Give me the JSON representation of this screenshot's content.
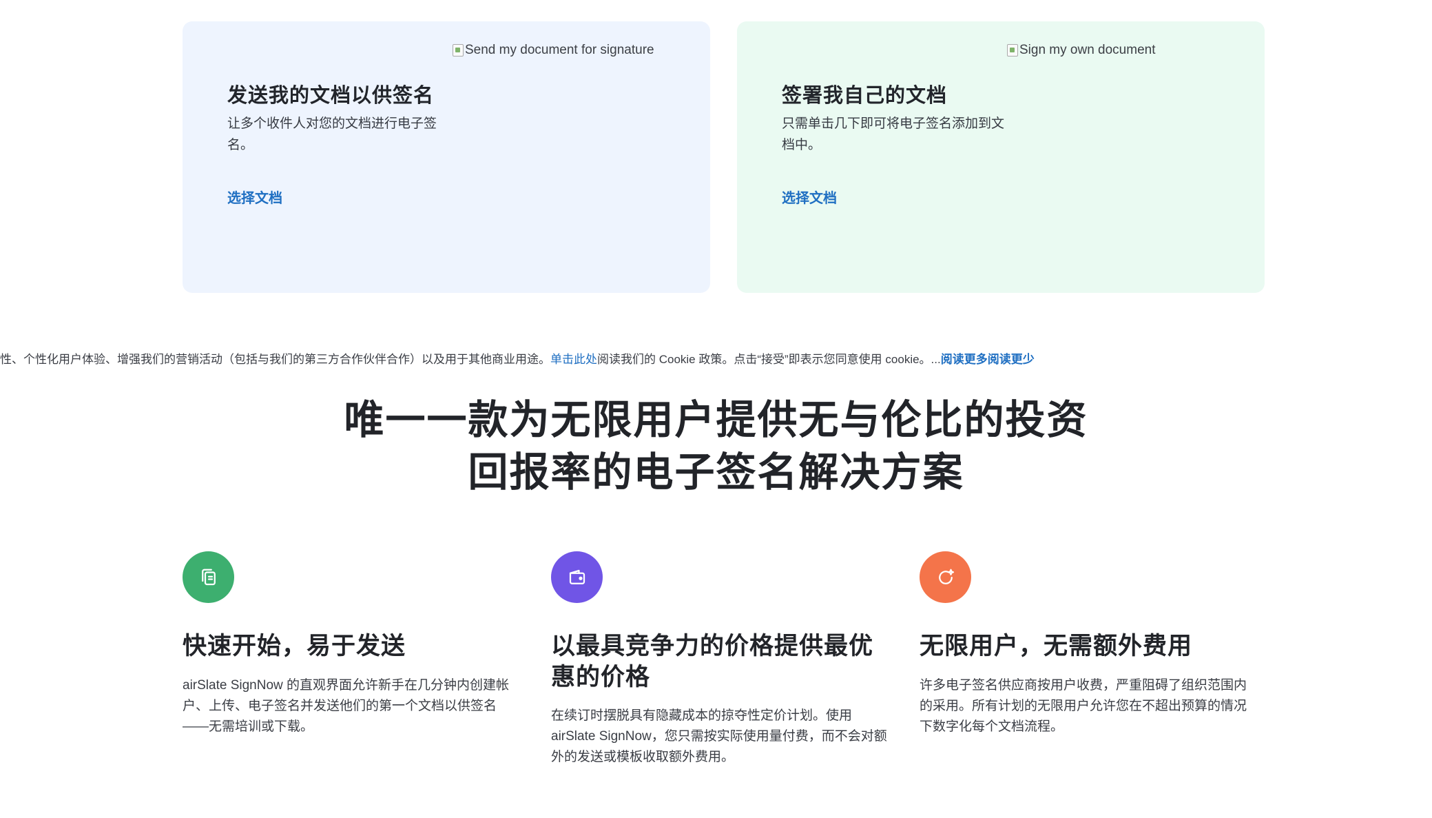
{
  "cards": [
    {
      "image_alt": "Send my document for signature",
      "title": "发送我的文档以供签名",
      "description": "让多个收件人对您的文档进行电子签名。",
      "link": "选择文档",
      "background": "#eef4fe"
    },
    {
      "image_alt": "Sign my own document",
      "title": "签署我自己的文档",
      "description": "只需单击几下即可将电子签名添加到文档中。",
      "link": "选择文档",
      "background": "#eafaf2"
    }
  ],
  "cookie_banner": {
    "text_before": "性、个性化用户体验、增强我们的营销活动（包括与我们的第三方合作伙伴合作）以及用于其他商业用途。",
    "link_here": "单击此处",
    "text_after": "阅读我们的 Cookie 政策。点击“接受”即表示您同意使用 cookie。...",
    "read_more": "阅读更多",
    "read_less": "阅读更少"
  },
  "headline": {
    "line1": "唯一一款为无限用户提供无与伦比的投资",
    "line2": "回报率的电子签名解决方案"
  },
  "features": [
    {
      "icon": "document-copy-icon",
      "color": "#3daf6f",
      "title": "快速开始，易于发送",
      "text": "airSlate SignNow 的直观界面允许新手在几分钟内创建帐户、上传、电子签名并发送他们的第一个文档以供签名——无需培训或下载。"
    },
    {
      "icon": "wallet-icon",
      "color": "#7055e6",
      "title": "以最具竞争力的价格提供最优惠的价格",
      "text": "在续订时摆脱具有隐藏成本的掠夺性定价计划。使用 airSlate SignNow，您只需按实际使用量付费，而不会对额外的发送或模板收取额外费用。"
    },
    {
      "icon": "refresh-sparkle-icon",
      "color": "#f4744a",
      "title": "无限用户，无需额外费用",
      "text": "许多电子签名供应商按用户收费，严重阻碍了组织范围内的采用。所有计划的无限用户允许您在不超出预算的情况下数字化每个文档流程。"
    }
  ]
}
